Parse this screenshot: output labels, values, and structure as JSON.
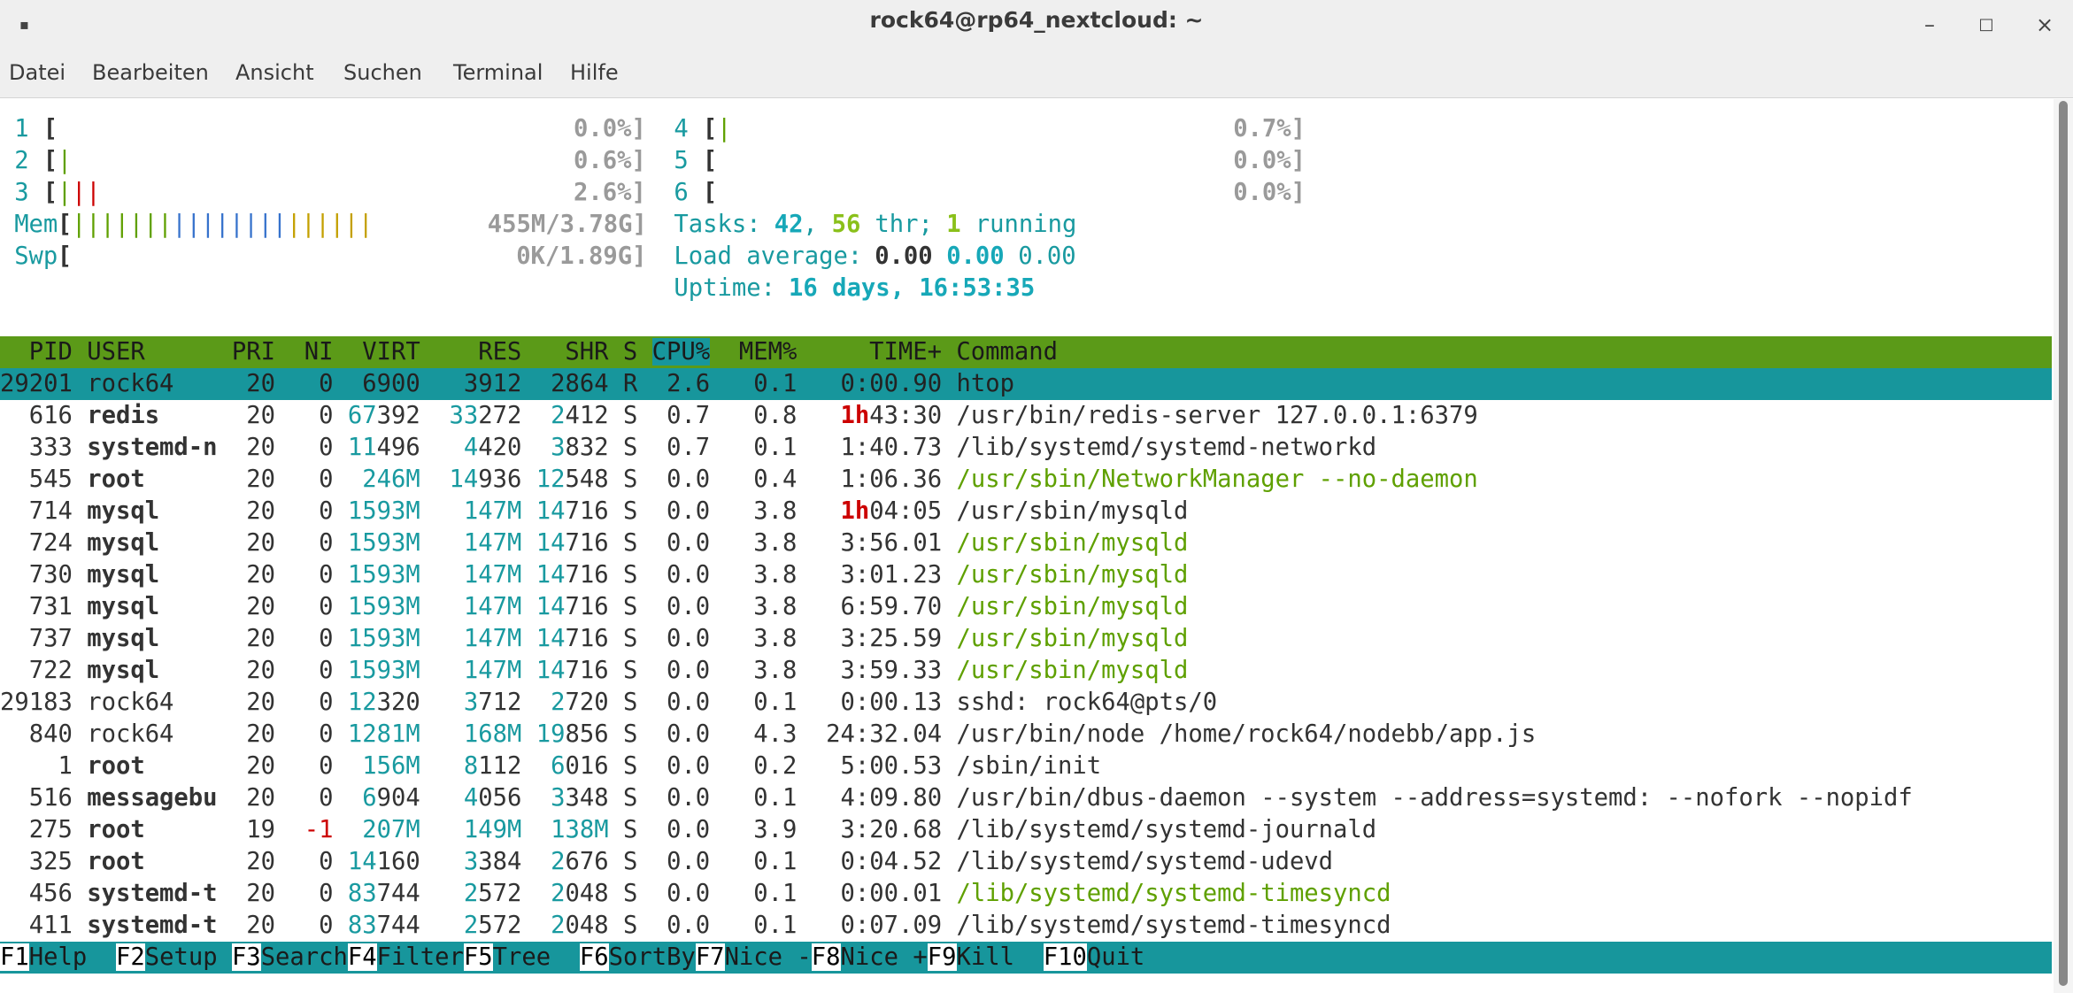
{
  "window": {
    "title": "rock64@rp64_nextcloud: ~",
    "minimize_glyph": "–",
    "maximize_glyph": "□",
    "close_glyph": "×",
    "app_icon": "pin-icon"
  },
  "menu": [
    "Datei",
    "Bearbeiten",
    "Ansicht",
    "Suchen",
    "Terminal",
    "Hilfe"
  ],
  "meters": {
    "cpus": [
      {
        "num": "1",
        "pct": "0.0%",
        "bars": []
      },
      {
        "num": "2",
        "pct": "0.6%",
        "bars": [
          "green"
        ]
      },
      {
        "num": "3",
        "pct": "2.6%",
        "bars": [
          "green",
          "red",
          "red"
        ]
      },
      {
        "num": "4",
        "pct": "0.7%",
        "bars": [
          "green"
        ]
      },
      {
        "num": "5",
        "pct": "0.0%",
        "bars": []
      },
      {
        "num": "6",
        "pct": "0.0%",
        "bars": []
      }
    ],
    "mem": {
      "label": "Mem",
      "value": "455M/3.78G",
      "bars": {
        "green": 7,
        "blue": 8,
        "yellow": 6
      }
    },
    "swp": {
      "label": "Swp",
      "value": "0K/1.89G"
    },
    "tasks": {
      "label": "Tasks:",
      "count": "42",
      "thr": "56",
      "thr_label": "thr;",
      "running": "1",
      "running_label": "running"
    },
    "load": {
      "label": "Load average:",
      "v1": "0.00",
      "v2": "0.00",
      "v3": "0.00"
    },
    "uptime": {
      "label": "Uptime:",
      "value": "16 days, 16:53:35"
    }
  },
  "columns": [
    "PID",
    "USER",
    "PRI",
    "NI",
    "VIRT",
    "RES",
    "SHR",
    "S",
    "CPU%",
    "MEM%",
    "TIME+",
    "Command"
  ],
  "processes": [
    {
      "pid": "29201",
      "user": "rock64",
      "pri": "20",
      "ni": "0",
      "virt": "6900",
      "res": "3912",
      "shr": "2864",
      "s": "R",
      "cpu": "2.6",
      "mem": "0.1",
      "time": "0:00.90",
      "cmd": "htop",
      "selected": true
    },
    {
      "pid": "616",
      "user": "redis",
      "pri": "20",
      "ni": "0",
      "virt": "67392",
      "res": "33272",
      "shr": "2412",
      "s": "S",
      "cpu": "0.7",
      "mem": "0.8",
      "time": "1h43:30",
      "cmd": "/usr/bin/redis-server 127.0.0.1:6379"
    },
    {
      "pid": "333",
      "user": "systemd-n",
      "pri": "20",
      "ni": "0",
      "virt": "11496",
      "res": "4420",
      "shr": "3832",
      "s": "S",
      "cpu": "0.7",
      "mem": "0.1",
      "time": "1:40.73",
      "cmd": "/lib/systemd/systemd-networkd"
    },
    {
      "pid": "545",
      "user": "root",
      "pri": "20",
      "ni": "0",
      "virt": "246M",
      "res": "14936",
      "shr": "12548",
      "s": "S",
      "cpu": "0.0",
      "mem": "0.4",
      "time": "1:06.36",
      "cmd": "/usr/sbin/NetworkManager --no-daemon",
      "thread": true
    },
    {
      "pid": "714",
      "user": "mysql",
      "pri": "20",
      "ni": "0",
      "virt": "1593M",
      "res": "147M",
      "shr": "14716",
      "s": "S",
      "cpu": "0.0",
      "mem": "3.8",
      "time": "1h04:05",
      "cmd": "/usr/sbin/mysqld"
    },
    {
      "pid": "724",
      "user": "mysql",
      "pri": "20",
      "ni": "0",
      "virt": "1593M",
      "res": "147M",
      "shr": "14716",
      "s": "S",
      "cpu": "0.0",
      "mem": "3.8",
      "time": "3:56.01",
      "cmd": "/usr/sbin/mysqld",
      "thread": true
    },
    {
      "pid": "730",
      "user": "mysql",
      "pri": "20",
      "ni": "0",
      "virt": "1593M",
      "res": "147M",
      "shr": "14716",
      "s": "S",
      "cpu": "0.0",
      "mem": "3.8",
      "time": "3:01.23",
      "cmd": "/usr/sbin/mysqld",
      "thread": true
    },
    {
      "pid": "731",
      "user": "mysql",
      "pri": "20",
      "ni": "0",
      "virt": "1593M",
      "res": "147M",
      "shr": "14716",
      "s": "S",
      "cpu": "0.0",
      "mem": "3.8",
      "time": "6:59.70",
      "cmd": "/usr/sbin/mysqld",
      "thread": true
    },
    {
      "pid": "737",
      "user": "mysql",
      "pri": "20",
      "ni": "0",
      "virt": "1593M",
      "res": "147M",
      "shr": "14716",
      "s": "S",
      "cpu": "0.0",
      "mem": "3.8",
      "time": "3:25.59",
      "cmd": "/usr/sbin/mysqld",
      "thread": true
    },
    {
      "pid": "722",
      "user": "mysql",
      "pri": "20",
      "ni": "0",
      "virt": "1593M",
      "res": "147M",
      "shr": "14716",
      "s": "S",
      "cpu": "0.0",
      "mem": "3.8",
      "time": "3:59.33",
      "cmd": "/usr/sbin/mysqld",
      "thread": true
    },
    {
      "pid": "29183",
      "user": "rock64",
      "pri": "20",
      "ni": "0",
      "virt": "12320",
      "res": "3712",
      "shr": "2720",
      "s": "S",
      "cpu": "0.0",
      "mem": "0.1",
      "time": "0:00.13",
      "cmd": "sshd: rock64@pts/0",
      "plainuser": true
    },
    {
      "pid": "840",
      "user": "rock64",
      "pri": "20",
      "ni": "0",
      "virt": "1281M",
      "res": "168M",
      "shr": "19856",
      "s": "S",
      "cpu": "0.0",
      "mem": "4.3",
      "time": "24:32.04",
      "cmd": "/usr/bin/node /home/rock64/nodebb/app.js",
      "plainuser": true
    },
    {
      "pid": "1",
      "user": "root",
      "pri": "20",
      "ni": "0",
      "virt": "156M",
      "res": "8112",
      "shr": "6016",
      "s": "S",
      "cpu": "0.0",
      "mem": "0.2",
      "time": "5:00.53",
      "cmd": "/sbin/init"
    },
    {
      "pid": "516",
      "user": "messagebu",
      "pri": "20",
      "ni": "0",
      "virt": "6904",
      "res": "4056",
      "shr": "3348",
      "s": "S",
      "cpu": "0.0",
      "mem": "0.1",
      "time": "4:09.80",
      "cmd": "/usr/bin/dbus-daemon --system --address=systemd: --nofork --nopidf"
    },
    {
      "pid": "275",
      "user": "root",
      "pri": "19",
      "ni": "-1",
      "virt": "207M",
      "res": "149M",
      "shr": "138M",
      "s": "S",
      "cpu": "0.0",
      "mem": "3.9",
      "time": "3:20.68",
      "cmd": "/lib/systemd/systemd-journald"
    },
    {
      "pid": "325",
      "user": "root",
      "pri": "20",
      "ni": "0",
      "virt": "14160",
      "res": "3384",
      "shr": "2676",
      "s": "S",
      "cpu": "0.0",
      "mem": "0.1",
      "time": "0:04.52",
      "cmd": "/lib/systemd/systemd-udevd"
    },
    {
      "pid": "456",
      "user": "systemd-t",
      "pri": "20",
      "ni": "0",
      "virt": "83744",
      "res": "2572",
      "shr": "2048",
      "s": "S",
      "cpu": "0.0",
      "mem": "0.1",
      "time": "0:00.01",
      "cmd": "/lib/systemd/systemd-timesyncd",
      "thread": true
    },
    {
      "pid": "411",
      "user": "systemd-t",
      "pri": "20",
      "ni": "0",
      "virt": "83744",
      "res": "2572",
      "shr": "2048",
      "s": "S",
      "cpu": "0.0",
      "mem": "0.1",
      "time": "0:07.09",
      "cmd": "/lib/systemd/systemd-timesyncd"
    }
  ],
  "function_keys": [
    {
      "key": "F1",
      "label": "Help  "
    },
    {
      "key": "F2",
      "label": "Setup "
    },
    {
      "key": "F3",
      "label": "Search"
    },
    {
      "key": "F4",
      "label": "Filter"
    },
    {
      "key": "F5",
      "label": "Tree  "
    },
    {
      "key": "F6",
      "label": "SortBy"
    },
    {
      "key": "F7",
      "label": "Nice -"
    },
    {
      "key": "F8",
      "label": "Nice +"
    },
    {
      "key": "F9",
      "label": "Kill  "
    },
    {
      "key": "F10",
      "label": "Quit  "
    }
  ],
  "colors": {
    "header_bg": "#5b9a18",
    "selection_bg": "#17969c",
    "teal": "#199aa0",
    "thread_green": "#5fa000",
    "red": "#cc0000"
  }
}
